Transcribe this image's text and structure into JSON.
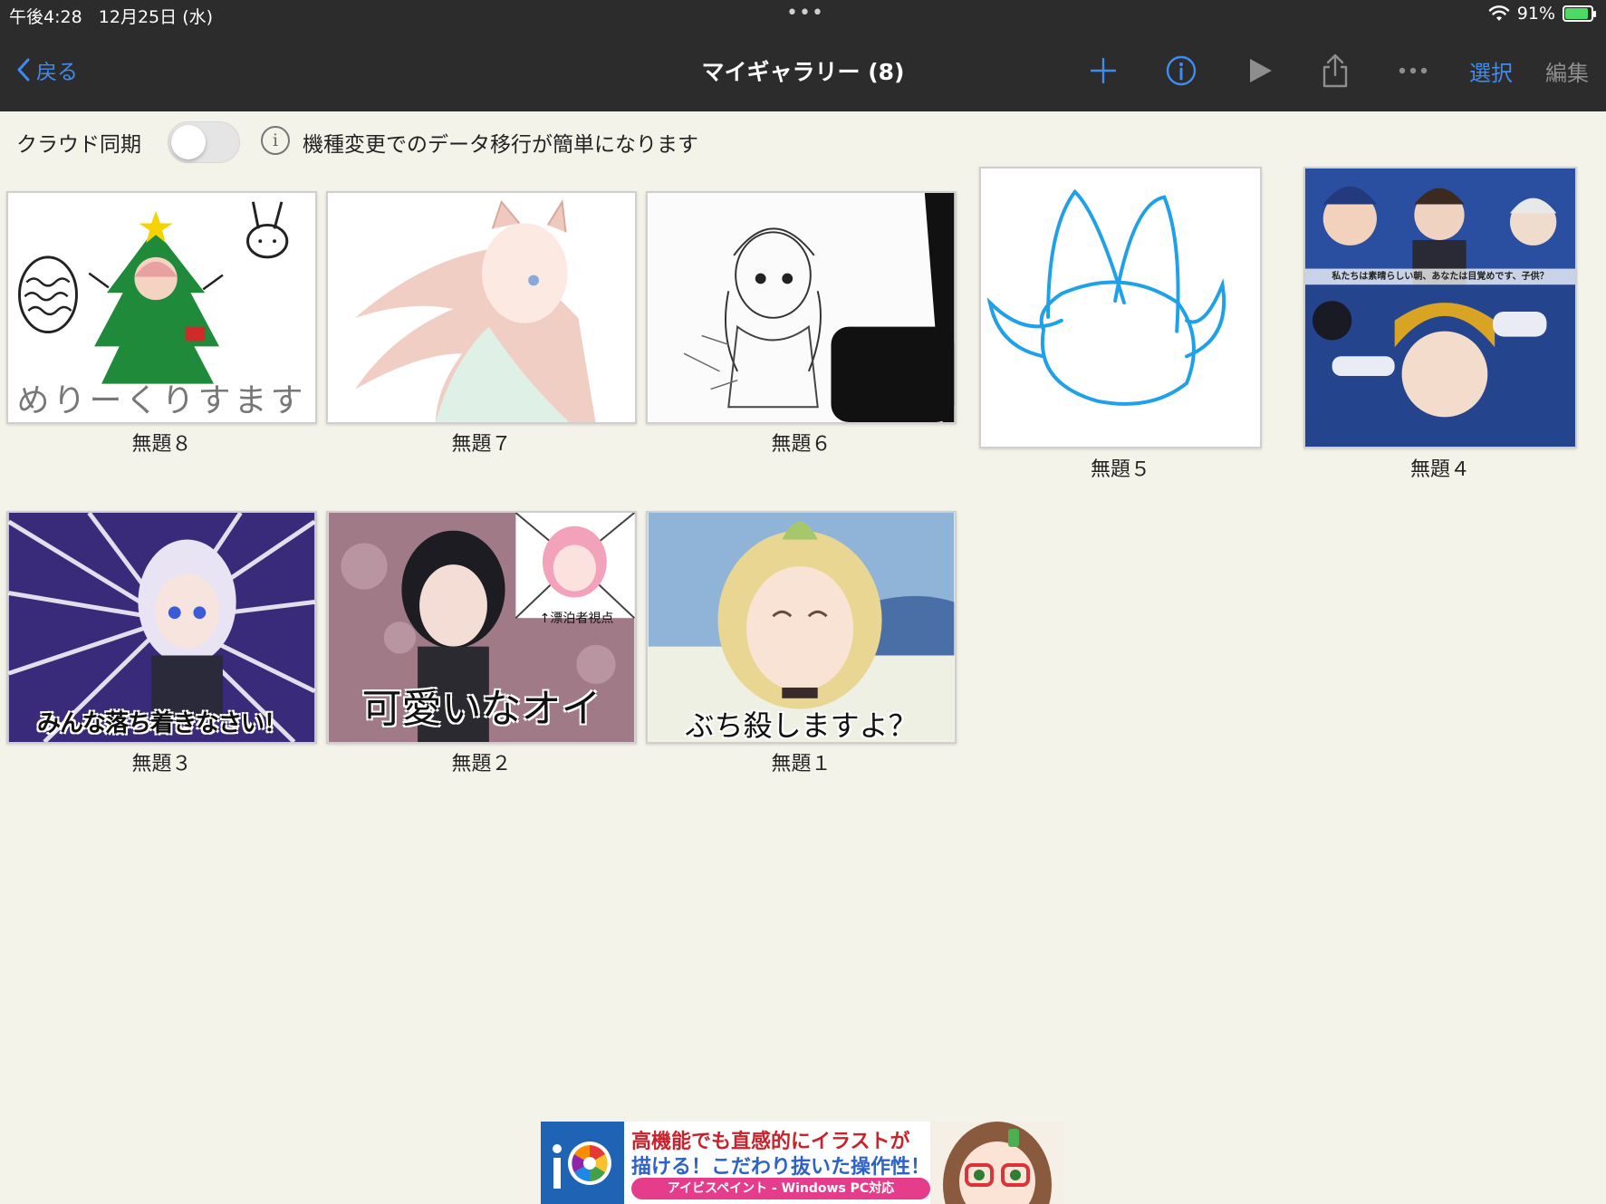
{
  "status_bar": {
    "time": "午後4:28",
    "date": "12月25日 (水)",
    "dots": "•••",
    "battery": "91%",
    "battery_level": 0.91
  },
  "nav": {
    "back_label": "戻る",
    "title": "マイギャラリー (8)",
    "select_label": "選択",
    "edit_label": "編集",
    "accent_color": "#3f8cf0"
  },
  "sync": {
    "label": "クラウド同期",
    "info_text": "機種変更でのデータ移行が簡単になります",
    "toggle_on": false
  },
  "gallery": {
    "items": [
      {
        "title": "無題８",
        "drawn_text": "めりーくりすます"
      },
      {
        "title": "無題７"
      },
      {
        "title": "無題６"
      },
      {
        "title": "無題５"
      },
      {
        "title": "無題４",
        "overlay_text": "私たちは素晴らしい朝、あなたは目覚めです、子供？"
      },
      {
        "title": "無題３",
        "overlay_text": "みんな落ち着きなさい！"
      },
      {
        "title": "無題２",
        "overlay_text": "可愛いなオイ",
        "sub_text": "↑漂泊者視点"
      },
      {
        "title": "無題１",
        "overlay_text": "ぶち殺しますよ？"
      }
    ]
  },
  "ad": {
    "line1": "高機能でも直感的にイラストが",
    "line2": "描ける！こだわり抜いた操作性！",
    "line3": "アイビスペイント - Windows PC対応"
  }
}
